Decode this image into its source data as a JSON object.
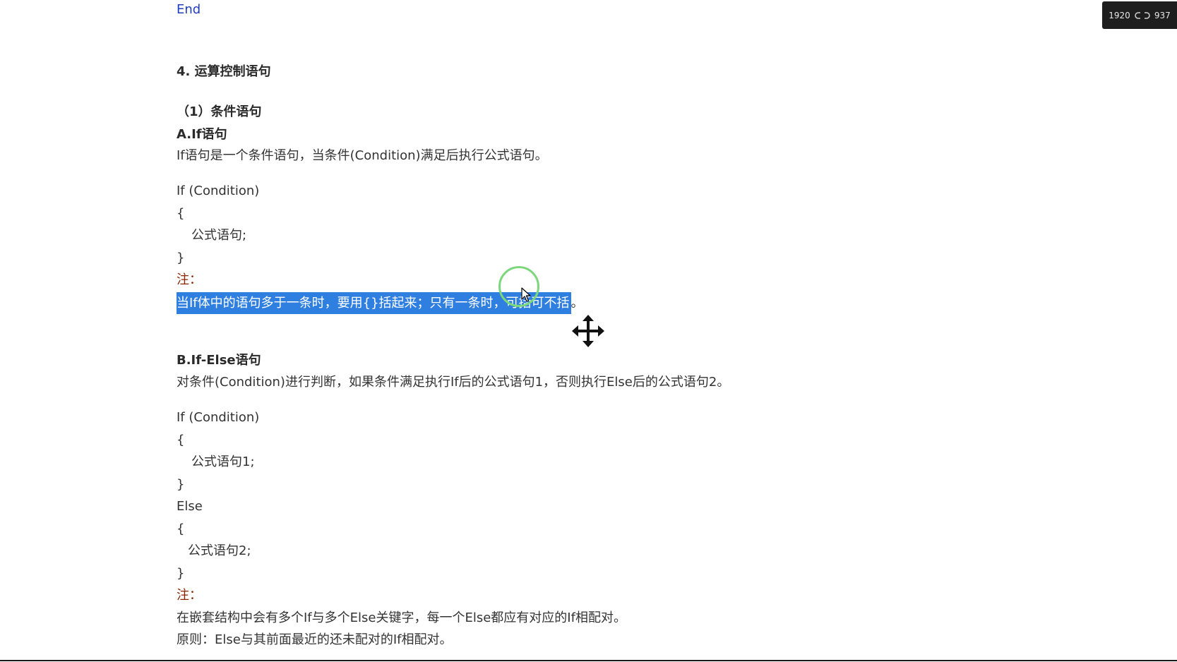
{
  "overlay": {
    "width_value": "1920",
    "height_value": "937",
    "link_icon": "link-icon"
  },
  "doc": {
    "end_keyword": "End",
    "section_title": "4. 运算控制语句",
    "subsection_title": "（1）条件语句",
    "if_block": {
      "title": "A.If语句",
      "description": "If语句是一个条件语句，当条件(Condition)满足后执行公式语句。",
      "code": [
        "If (Condition)",
        "{",
        "公式语句;",
        "}"
      ],
      "note_label": "注：",
      "note_selected": "当If体中的语句多于一条时，要用{}括起来；只有一条时，可括可不括",
      "note_tail": "。"
    },
    "if_else_block": {
      "title": "B.If-Else语句",
      "description": "对条件(Condition)进行判断，如果条件满足执行If后的公式语句1，否则执行Else后的公式语句2。",
      "code": [
        "If (Condition)",
        "{",
        "公式语句1;",
        "}",
        "Else",
        "{",
        "公式语句2;",
        "}"
      ],
      "note_label": "注：",
      "notes": [
        "在嵌套结构中会有多个If与多个Else关键字，每一个Else都应有对应的If相配对。",
        "原则：Else与其前面最近的还未配对的If相配对。"
      ]
    }
  },
  "colors": {
    "selection": "#2f7fe0",
    "focus_ring": "#7cd67c",
    "keyword_blue": "#1f3fbf",
    "note_label": "#8b2500"
  },
  "icons": {
    "cursor": "arrow-pointer-icon",
    "move": "move-arrows-icon"
  }
}
